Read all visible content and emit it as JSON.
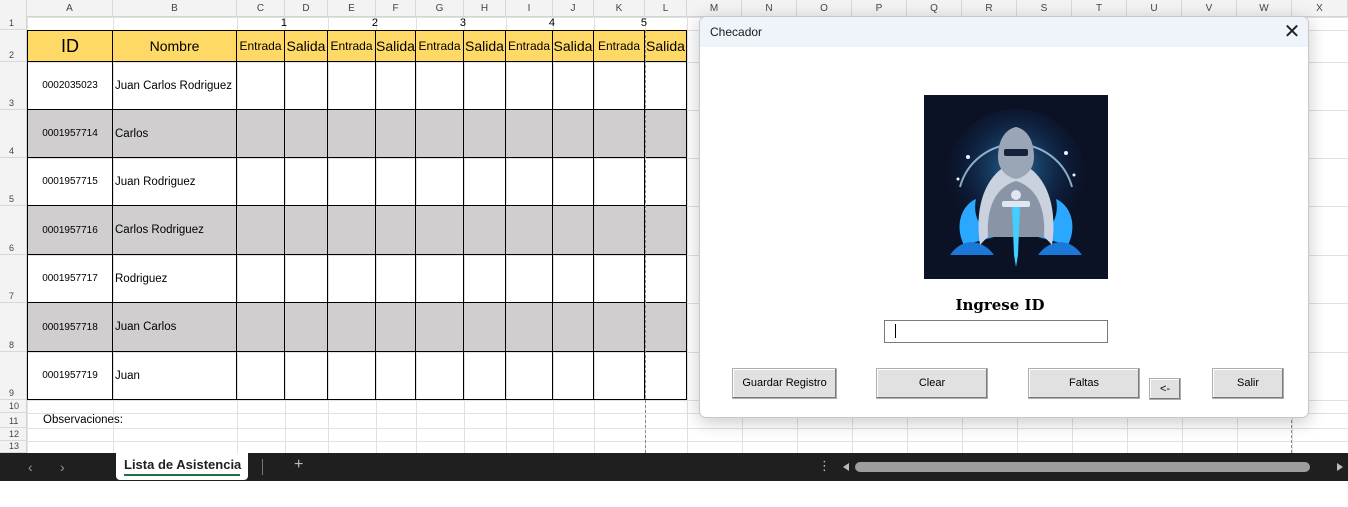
{
  "sheet": {
    "columns": [
      "A",
      "B",
      "C",
      "D",
      "E",
      "F",
      "G",
      "H",
      "I",
      "J",
      "K",
      "L",
      "M",
      "N",
      "O",
      "P",
      "Q",
      "R",
      "S",
      "T",
      "U",
      "V",
      "W",
      "X"
    ],
    "row_numbers": [
      "1",
      "2",
      "3",
      "4",
      "5",
      "6",
      "7",
      "8",
      "9",
      "10",
      "11",
      "12",
      "13"
    ],
    "day_numbers": [
      "1",
      "2",
      "3",
      "4",
      "5"
    ],
    "header": {
      "id": "ID",
      "name": "Nombre",
      "day_cols": [
        "Entrada",
        "Salida",
        "Entrada",
        "Salida",
        "Entrada",
        "Salida",
        "Entrada",
        "Salida",
        "Entrada",
        "Salida"
      ]
    },
    "rows": [
      {
        "id": "0002035023",
        "name": "Juan Carlos Rodriguez"
      },
      {
        "id": "0001957714",
        "name": "Carlos"
      },
      {
        "id": "0001957715",
        "name": "Juan  Rodriguez"
      },
      {
        "id": "0001957716",
        "name": " Carlos Rodriguez"
      },
      {
        "id": "0001957717",
        "name": "Rodriguez"
      },
      {
        "id": "0001957718",
        "name": "Juan Carlos"
      },
      {
        "id": "0001957719",
        "name": "Juan"
      }
    ],
    "observations_label": "Observaciones:"
  },
  "tabs": {
    "prev_arrow": "‹",
    "next_arrow": "›",
    "active_tab": "Lista de Asistencia",
    "add_sheet": "+",
    "more": "⋮"
  },
  "dialog": {
    "title": "Checador",
    "close_glyph": "✕",
    "logo_icon": "knight-emblem-icon",
    "prompt": "Ingrese ID",
    "input_value": "",
    "buttons": {
      "save": "Guardar Registro",
      "clear": "Clear",
      "absences": "Faltas",
      "backspace": "<-",
      "exit": "Salir"
    }
  },
  "colors": {
    "header_fill": "#ffd966",
    "grey_row": "#d0cece",
    "tab_bar": "#1f1f1f",
    "accent_green": "#1e7145"
  }
}
